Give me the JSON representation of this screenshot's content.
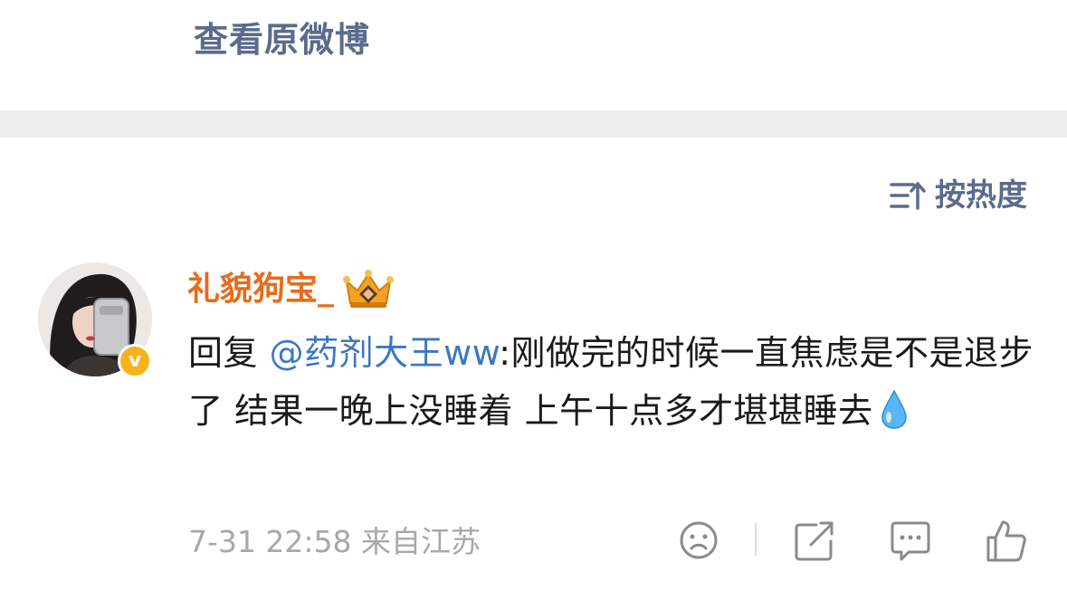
{
  "header": {
    "view_original": "查看原微博"
  },
  "sort": {
    "label": "按热度",
    "icon": "sort-icon"
  },
  "comment": {
    "username": "礼貌狗宝_",
    "user_badge": "crown-icon",
    "verified_badge": "v",
    "reply_prefix": "回复",
    "mention": "@药剂大王ww",
    "text": ":刚做完的时候一直焦虑是不是退步了 结果一晚上没睡着 上午十点多才堪堪睡去",
    "emoji": "droplet-icon",
    "timestamp": "7-31 22:58",
    "location": "来自江苏"
  },
  "actions": [
    "sad-face-icon",
    "share-icon",
    "comment-icon",
    "like-icon"
  ],
  "colors": {
    "link": "#5b6b8c",
    "username": "#e86b1c",
    "mention": "#3d77c2",
    "meta": "#a8a8a8",
    "badge": "#f6b21a",
    "divider": "#efefef"
  }
}
